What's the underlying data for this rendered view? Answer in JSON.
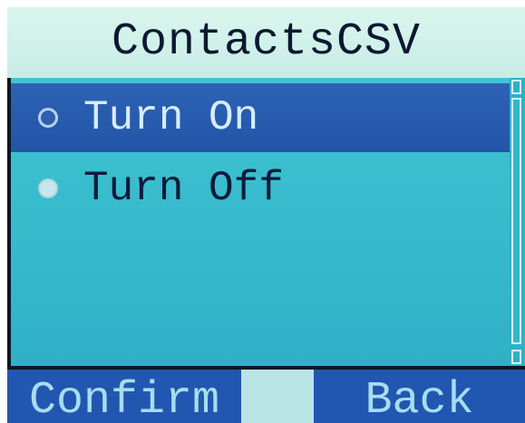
{
  "title": "ContactsCSV",
  "options": [
    {
      "label": "Turn On",
      "selected": true
    },
    {
      "label": "Turn Off",
      "selected": false
    }
  ],
  "softkeys": {
    "left": "Confirm",
    "right": "Back"
  },
  "colors": {
    "title_background": "#d9f6ee",
    "list_background": "#35b9cb",
    "selection_highlight": "#2c62b4",
    "softkey_background": "#2157b0"
  }
}
